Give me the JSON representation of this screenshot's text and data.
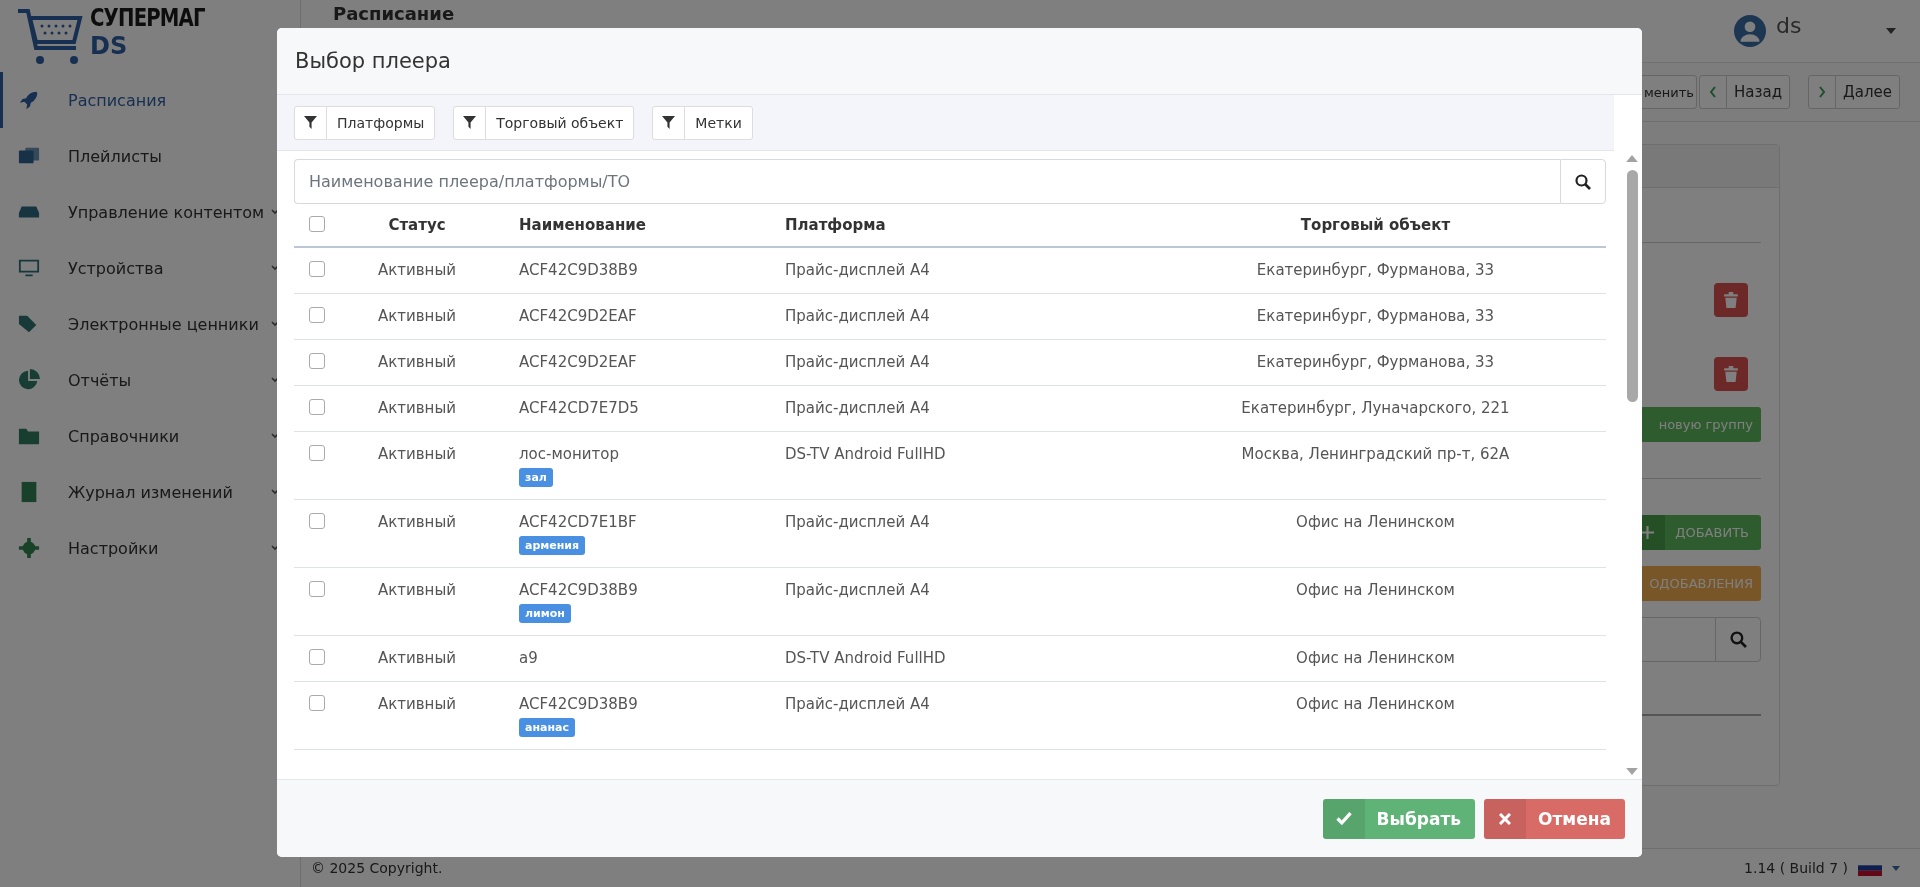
{
  "sidebar": {
    "logo": {
      "title": "СУПЕРМАГ",
      "subtitle": "DS"
    },
    "items": [
      {
        "label": "Расписания",
        "selected": true,
        "expandable": false
      },
      {
        "label": "Плейлисты",
        "selected": false,
        "expandable": false
      },
      {
        "label": "Управление контентом",
        "selected": false,
        "expandable": true
      },
      {
        "label": "Устройства",
        "selected": false,
        "expandable": true
      },
      {
        "label": "Электронные ценники",
        "selected": false,
        "expandable": true
      },
      {
        "label": "Отчёты",
        "selected": false,
        "expandable": true
      },
      {
        "label": "Справочники",
        "selected": false,
        "expandable": true
      },
      {
        "label": "Журнал изменений",
        "selected": false,
        "expandable": true
      },
      {
        "label": "Настройки",
        "selected": false,
        "expandable": true
      }
    ]
  },
  "header": {
    "title": "Расписание",
    "user": "ds"
  },
  "toolbar": [
    {
      "label": "менить",
      "kind": "plain"
    },
    {
      "label": "Назад",
      "kind": "prev"
    },
    {
      "label": "Далее",
      "kind": "next"
    }
  ],
  "panel": {
    "group_button": "новую группу",
    "add_button": "ДОБАВИТЬ",
    "pending_button": "ОДОБАВЛЕНИЯ"
  },
  "footer": {
    "copyright": "© 2025 Copyright.",
    "version": "1.14 ( Build 7 )"
  },
  "modal": {
    "title": "Выбор плеера",
    "filters": [
      "Платформы",
      "Торговый объект",
      "Метки"
    ],
    "search": {
      "placeholder": "Наименование плеера/платформы/ТО"
    },
    "columns": [
      "Статус",
      "Наименование",
      "Платформа",
      "Торговый объект"
    ],
    "all_checked": false,
    "rows": [
      {
        "checked": false,
        "status": "Активный",
        "name": "ACF42C9D38B9",
        "platform": "Прайс-дисплей А4",
        "store": "Екатеринбург, Фурманова, 33"
      },
      {
        "checked": false,
        "status": "Активный",
        "name": "ACF42C9D2EAF",
        "platform": "Прайс-дисплей А4",
        "store": "Екатеринбург, Фурманова, 33"
      },
      {
        "checked": false,
        "status": "Активный",
        "name": "ACF42C9D2EAF",
        "platform": "Прайс-дисплей А4",
        "store": "Екатеринбург, Фурманова, 33"
      },
      {
        "checked": false,
        "status": "Активный",
        "name": "ACF42CD7E7D5",
        "platform": "Прайс-дисплей А4",
        "store": "Екатеринбург, Луначарского, 221"
      },
      {
        "checked": false,
        "status": "Активный",
        "name": "лос-монитор",
        "tag": "зал",
        "platform": "DS-TV Android FullHD",
        "store": "Москва, Ленинградский пр-т, 62А"
      },
      {
        "checked": false,
        "status": "Активный",
        "name": "ACF42CD7E1BF",
        "tag": "армения",
        "platform": "Прайс-дисплей А4",
        "store": "Офис на Ленинском"
      },
      {
        "checked": false,
        "status": "Активный",
        "name": "ACF42C9D38B9",
        "tag": "лимон",
        "platform": "Прайс-дисплей А4",
        "store": "Офис на Ленинском"
      },
      {
        "checked": false,
        "status": "Активный",
        "name": "a9",
        "platform": "DS-TV Android FullHD",
        "store": "Офис на Ленинском"
      },
      {
        "checked": false,
        "status": "Активный",
        "name": "ACF42C9D38B9",
        "tag": "ананас",
        "platform": "Прайс-дисплей А4",
        "store": "Офис на Ленинском"
      }
    ],
    "buttons": [
      {
        "label": "Выбрать",
        "kind": "confirm"
      },
      {
        "label": "Отмена",
        "kind": "cancel"
      }
    ]
  }
}
